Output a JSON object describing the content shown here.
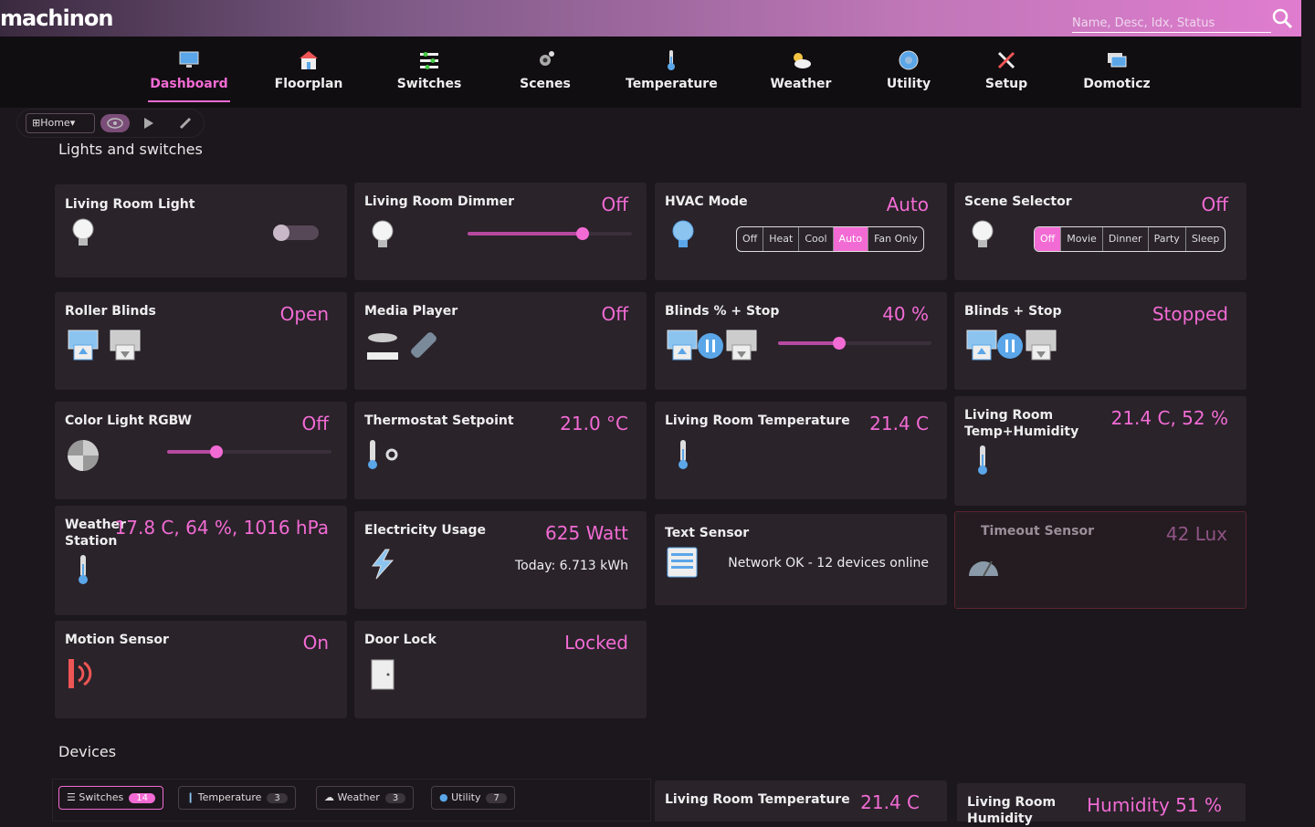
{
  "app": {
    "logo": "machinon",
    "search_placeholder": "Name, Desc, Idx, Status"
  },
  "nav": [
    {
      "label": "Dashboard",
      "icon": "monitor-icon",
      "active": true
    },
    {
      "label": "Floorplan",
      "icon": "house-icon"
    },
    {
      "label": "Switches",
      "icon": "switches-icon"
    },
    {
      "label": "Scenes",
      "icon": "scenes-icon"
    },
    {
      "label": "Temperature",
      "icon": "thermometer-icon"
    },
    {
      "label": "Weather",
      "icon": "weather-icon"
    },
    {
      "label": "Utility",
      "icon": "utility-icon"
    },
    {
      "label": "Setup",
      "icon": "tools-icon"
    },
    {
      "label": "Domoticz",
      "icon": "windows-icon"
    }
  ],
  "toolbar": {
    "home": "⊞Home▾"
  },
  "sections": {
    "lights": "Lights and switches",
    "devices": "Devices"
  },
  "cards": {
    "living_room_light": {
      "name": "Living Room Light"
    },
    "living_room_dimmer": {
      "name": "Living Room Dimmer",
      "value": "Off",
      "level": 0.7
    },
    "hvac_mode": {
      "name": "HVAC Mode",
      "value": "Auto",
      "options": [
        "Off",
        "Heat",
        "Cool",
        "Auto",
        "Fan Only"
      ],
      "selected": "Auto"
    },
    "scene_selector": {
      "name": "Scene Selector",
      "value": "Off",
      "options": [
        "Off",
        "Movie",
        "Dinner",
        "Party",
        "Sleep"
      ],
      "selected": "Off"
    },
    "roller_blinds": {
      "name": "Roller Blinds",
      "value": "Open"
    },
    "media_player": {
      "name": "Media Player",
      "value": "Off"
    },
    "blinds_pct_stop": {
      "name": "Blinds % + Stop",
      "value": "40 %",
      "level": 0.4
    },
    "blinds_stop": {
      "name": "Blinds + Stop",
      "value": "Stopped"
    },
    "color_light": {
      "name": "Color Light RGBW",
      "value": "Off",
      "level": 0.3
    },
    "thermostat": {
      "name": "Thermostat Setpoint",
      "value": "21.0 °C"
    },
    "lr_temp": {
      "name": "Living Room Temperature",
      "value": "21.4 C"
    },
    "lr_temp_hum": {
      "name": "Living Room Temp+Humidity",
      "value": "21.4 C, 52 %"
    },
    "weather_station": {
      "name": "Weather Station",
      "value": "17.8 C, 64 %, 1016 hPa"
    },
    "electricity": {
      "name": "Electricity Usage",
      "value": "625 Watt",
      "today": "Today: 6.713 kWh"
    },
    "text_sensor": {
      "name": "Text Sensor",
      "text": "Network OK - 12 devices online"
    },
    "timeout_sensor": {
      "name": "Timeout Sensor",
      "value": "42 Lux"
    },
    "motion_sensor": {
      "name": "Motion Sensor",
      "value": "On"
    },
    "door_lock": {
      "name": "Door Lock",
      "value": "Locked"
    }
  },
  "device_tabs": [
    {
      "label": "Switches",
      "count": "14",
      "icon": "list-icon",
      "active": true
    },
    {
      "label": "Temperature",
      "count": "3",
      "icon": "thermometer-icon"
    },
    {
      "label": "Weather",
      "count": "3",
      "icon": "cloud-icon"
    },
    {
      "label": "Utility",
      "count": "7",
      "icon": "utility-icon"
    }
  ],
  "bottom_cards": {
    "lr_temp": {
      "name": "Living Room Temperature",
      "value": "21.4 C"
    },
    "lr_humidity": {
      "name": "Living Room Humidity",
      "value": "Humidity 51 %"
    }
  },
  "colors": {
    "accent": "#f26bd4",
    "card": "#2a232a",
    "bg": "#1c171c",
    "navbar": "#110e11"
  }
}
